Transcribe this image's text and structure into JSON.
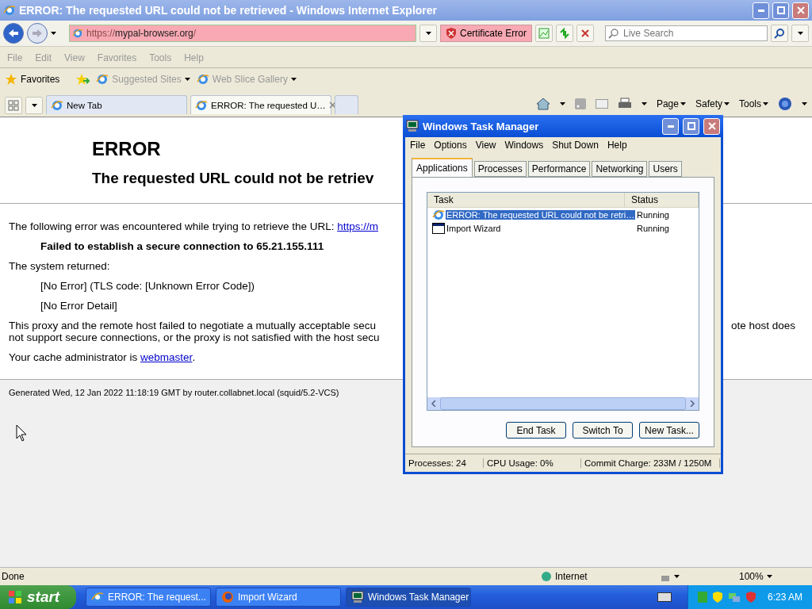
{
  "window": {
    "title": "ERROR: The requested URL could not be retrieved - Windows Internet Explorer"
  },
  "address_bar": {
    "url_scheme": "https://",
    "url_host": "mypal-browser.org",
    "url_tail": "/",
    "certificate_error": "Certificate Error"
  },
  "search": {
    "placeholder": "Live Search"
  },
  "menu": [
    "File",
    "Edit",
    "View",
    "Favorites",
    "Tools",
    "Help"
  ],
  "favorites_bar": {
    "favorites": "Favorites",
    "links": [
      "Suggested Sites",
      "Web Slice Gallery"
    ]
  },
  "tabs": [
    {
      "label": "New Tab",
      "selected": false
    },
    {
      "label": "ERROR: The requested U…",
      "selected": true
    }
  ],
  "command_bar": [
    "Page",
    "Safety",
    "Tools"
  ],
  "page": {
    "heading": "ERROR",
    "subheading": "The requested URL could not be retriev",
    "intro": "The following error was encountered while trying to retrieve the URL: ",
    "intro_link": "https://m",
    "failure": "Failed to establish a secure connection to 65.21.155.111",
    "system_returned": "The system returned:",
    "details": [
      "[No Error] (TLS code: [Unknown Error Code])",
      "[No Error Detail]"
    ],
    "explanation_left": [
      "This proxy and the remote host failed to negotiate a mutually acceptable secu",
      "not support secure connections, or the proxy is not satisfied with the host secu"
    ],
    "explanation_right": "ote host does",
    "admin": "Your cache administrator is ",
    "admin_link": "webmaster",
    "admin_end": ".",
    "footer": "Generated Wed, 12 Jan 2022 11:18:19 GMT by router.collabnet.local (squid/5.2-VCS)"
  },
  "status_bar": {
    "text": "Done",
    "zone": "Internet",
    "zoom": "100%"
  },
  "task_manager": {
    "title": "Windows Task Manager",
    "menu": [
      "File",
      "Options",
      "View",
      "Windows",
      "Shut Down",
      "Help"
    ],
    "tabs": [
      {
        "label": "Applications",
        "selected": true
      },
      {
        "label": "Processes",
        "selected": false
      },
      {
        "label": "Performance",
        "selected": false
      },
      {
        "label": "Networking",
        "selected": false
      },
      {
        "label": "Users",
        "selected": false
      }
    ],
    "columns": [
      "Task",
      "Status"
    ],
    "rows": [
      {
        "task": "ERROR: The requested URL could not be retri…",
        "status": "Running",
        "selected": true,
        "kind": "browser"
      },
      {
        "task": "Import Wizard",
        "status": "Running",
        "selected": false,
        "kind": "window"
      }
    ],
    "buttons": [
      "End Task",
      "Switch To",
      "New Task..."
    ],
    "status": [
      "Processes: 24",
      "CPU Usage: 0%",
      "Commit Charge: 233M / 1250M"
    ]
  },
  "taskbar": {
    "start": "start",
    "items": [
      {
        "label": "ERROR: The request...",
        "selected": false,
        "kind": "browser"
      },
      {
        "label": "Import Wizard",
        "selected": false,
        "kind": "firefox"
      },
      {
        "label": "Windows Task Manager",
        "selected": true,
        "kind": "taskmgr"
      }
    ],
    "clock": "6:23 AM"
  }
}
